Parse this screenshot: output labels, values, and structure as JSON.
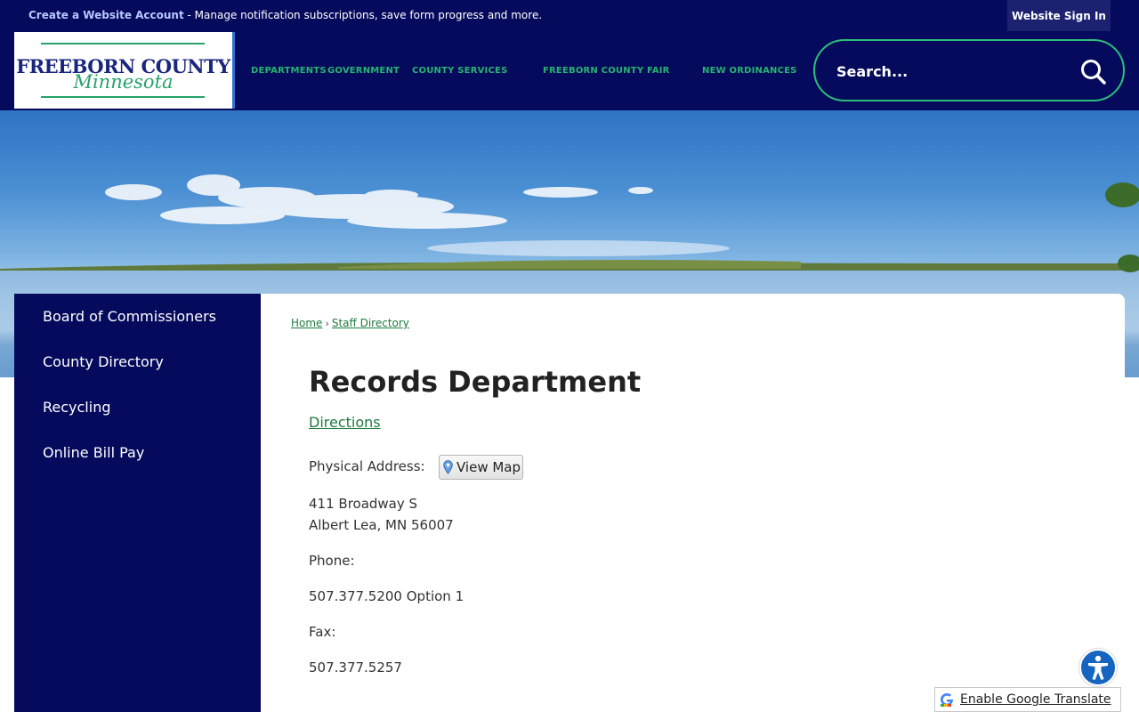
{
  "topbar": {
    "account_link": "Create a Website Account",
    "account_message": " - Manage notification subscriptions, save form progress and more.",
    "signin_label": "Website Sign In"
  },
  "logo": {
    "line1": "FREEBORN COUNTY",
    "line2": "Minnesota"
  },
  "nav": {
    "items": [
      {
        "label": "DEPARTMENTS"
      },
      {
        "label": "GOVERNMENT"
      },
      {
        "label": "COUNTY SERVICES"
      },
      {
        "label": "FREEBORN COUNTY FAIR"
      },
      {
        "label": "NEW ORDINANCES"
      }
    ]
  },
  "search": {
    "placeholder": "Search...",
    "icon": "search-icon"
  },
  "sidebar": {
    "items": [
      {
        "label": "Board of Commissioners"
      },
      {
        "label": "County Directory"
      },
      {
        "label": "Recycling"
      },
      {
        "label": "Online Bill Pay"
      }
    ]
  },
  "breadcrumb": {
    "home": "Home",
    "separator": "›",
    "current": "Staff Directory"
  },
  "page": {
    "title": "Records Department",
    "directions_link": "Directions",
    "physical_address_label": "Physical Address:",
    "view_map_label": "View Map",
    "address_line1": "411 Broadway S",
    "address_line2": "Albert Lea, MN 56007",
    "phone_label": "Phone:",
    "phone_value": "507.377.5200 Option 1",
    "fax_label": "Fax:",
    "fax_value": "507.377.5257"
  },
  "widgets": {
    "translate_label": "Enable Google Translate",
    "accessibility_icon": "accessibility-icon"
  },
  "colors": {
    "navy": "#050a5c",
    "accent_green": "#27b46f",
    "link_green": "#1d7a3e"
  }
}
